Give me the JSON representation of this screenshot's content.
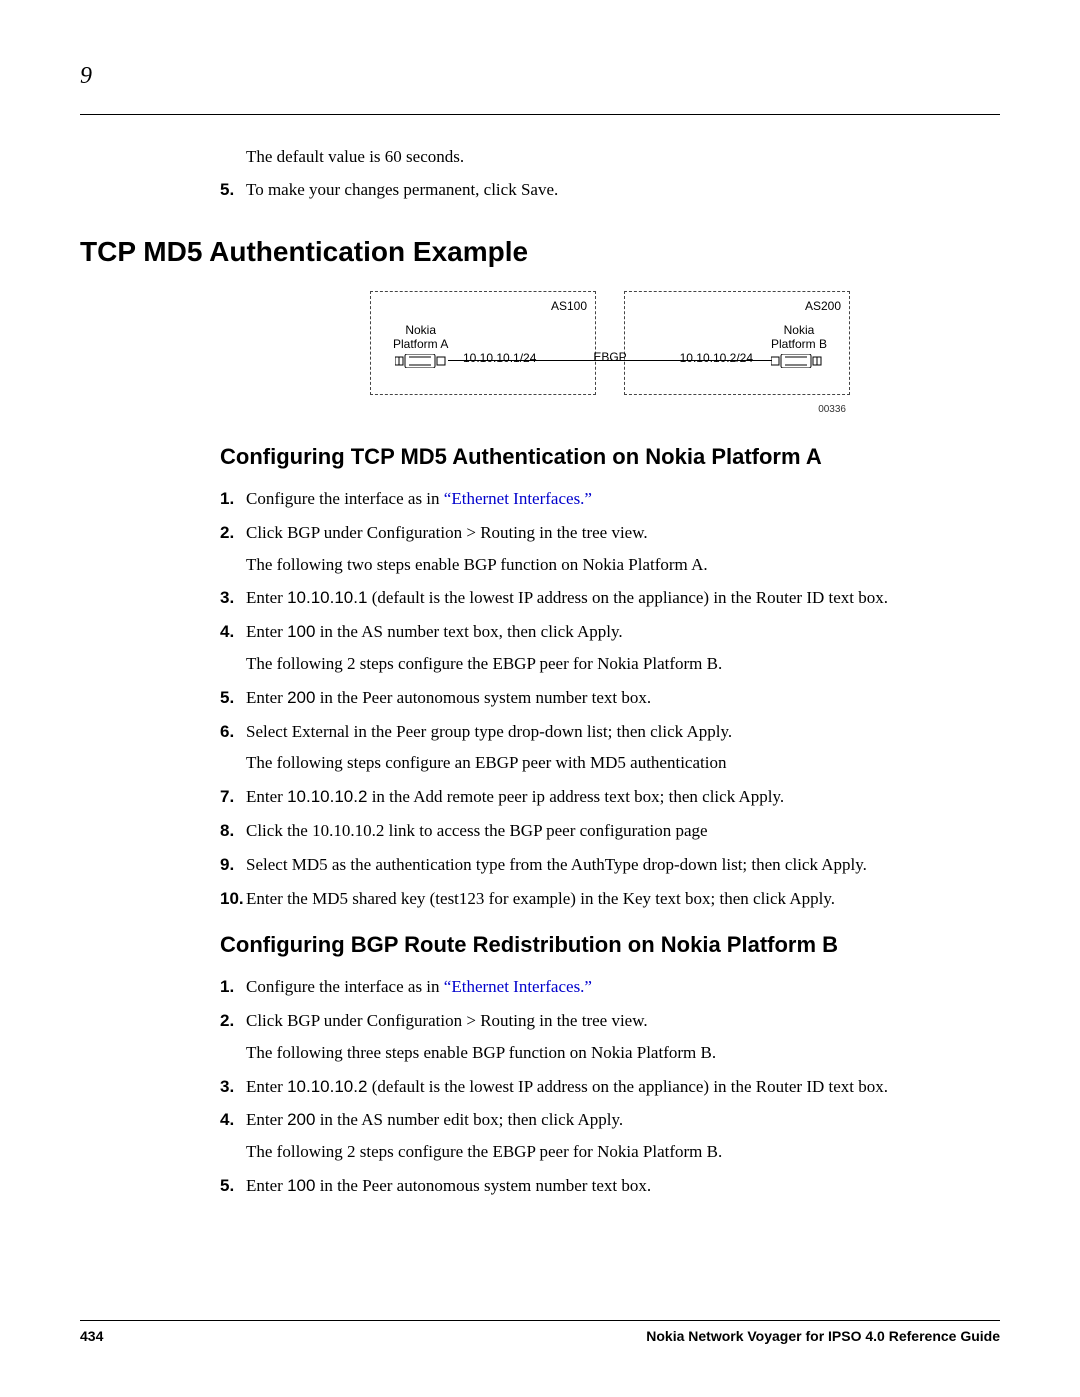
{
  "chapter": "9",
  "intro": {
    "para": "The default value is 60 seconds.",
    "item5_num": "5.",
    "item5_text": "To make your changes permanent, click Save."
  },
  "h1": "TCP MD5 Authentication Example",
  "diagram": {
    "as100": "AS100",
    "as200": "AS200",
    "plat_a_1": "Nokia",
    "plat_a_2": "Platform A",
    "plat_b_1": "Nokia",
    "plat_b_2": "Platform B",
    "ip_a": "10.10.10.1/24",
    "ip_b": "10.10.10.2/24",
    "ebgp": "EBGP",
    "figid": "00336"
  },
  "h2a": "Configuring TCP MD5 Authentication on Nokia Platform A",
  "secA": {
    "n1": "1.",
    "t1a": "Configure the interface as in ",
    "t1b": "“Ethernet Interfaces.”",
    "n2": "2.",
    "t2": "Click BGP under Configuration > Routing in the tree view.",
    "t2p": "The following two steps enable BGP function on Nokia Platform A.",
    "n3": "3.",
    "t3a": "Enter ",
    "t3code": "10.10.10.1",
    "t3b": " (default is the lowest IP address on the appliance) in the Router ID text box.",
    "n4": "4.",
    "t4a": "Enter ",
    "t4code": "100",
    "t4b": " in the AS number text box, then click Apply.",
    "t4p": "The following 2 steps configure the EBGP peer for Nokia Platform B.",
    "n5": "5.",
    "t5a": "Enter ",
    "t5code": "200",
    "t5b": " in the Peer autonomous system number text box.",
    "n6": "6.",
    "t6": "Select External in the Peer group type drop-down list; then click Apply.",
    "t6p": "The following steps configure an EBGP peer with MD5 authentication",
    "n7": "7.",
    "t7a": "Enter ",
    "t7code": "10.10.10.2",
    "t7b": " in the Add remote peer ip address text box; then click Apply.",
    "n8": "8.",
    "t8": "Click the 10.10.10.2 link to access the BGP peer configuration page",
    "n9": "9.",
    "t9": "Select MD5 as the authentication type from the AuthType drop-down list; then click Apply.",
    "n10": "10.",
    "t10": "Enter the MD5 shared key (test123 for example) in the Key text box; then click Apply."
  },
  "h2b": "Configuring BGP Route Redistribution on Nokia Platform B",
  "secB": {
    "n1": "1.",
    "t1a": "Configure the interface as in ",
    "t1b": "“Ethernet Interfaces.”",
    "n2": "2.",
    "t2": "Click BGP under Configuration > Routing in the tree view.",
    "t2p": "The following three steps enable BGP function on Nokia Platform B.",
    "n3": "3.",
    "t3a": "Enter ",
    "t3code": "10.10.10.2",
    "t3b": " (default is the lowest IP address on the appliance) in the Router ID text box.",
    "n4": "4.",
    "t4a": "Enter ",
    "t4code": "200",
    "t4b": " in the AS number edit box; then click Apply.",
    "t4p": "The following 2 steps configure the EBGP peer for Nokia Platform B.",
    "n5": "5.",
    "t5a": "Enter ",
    "t5code": "100",
    "t5b": " in the Peer autonomous system number text box."
  },
  "footer": {
    "page": "434",
    "title": "Nokia Network Voyager for IPSO 4.0 Reference Guide"
  }
}
